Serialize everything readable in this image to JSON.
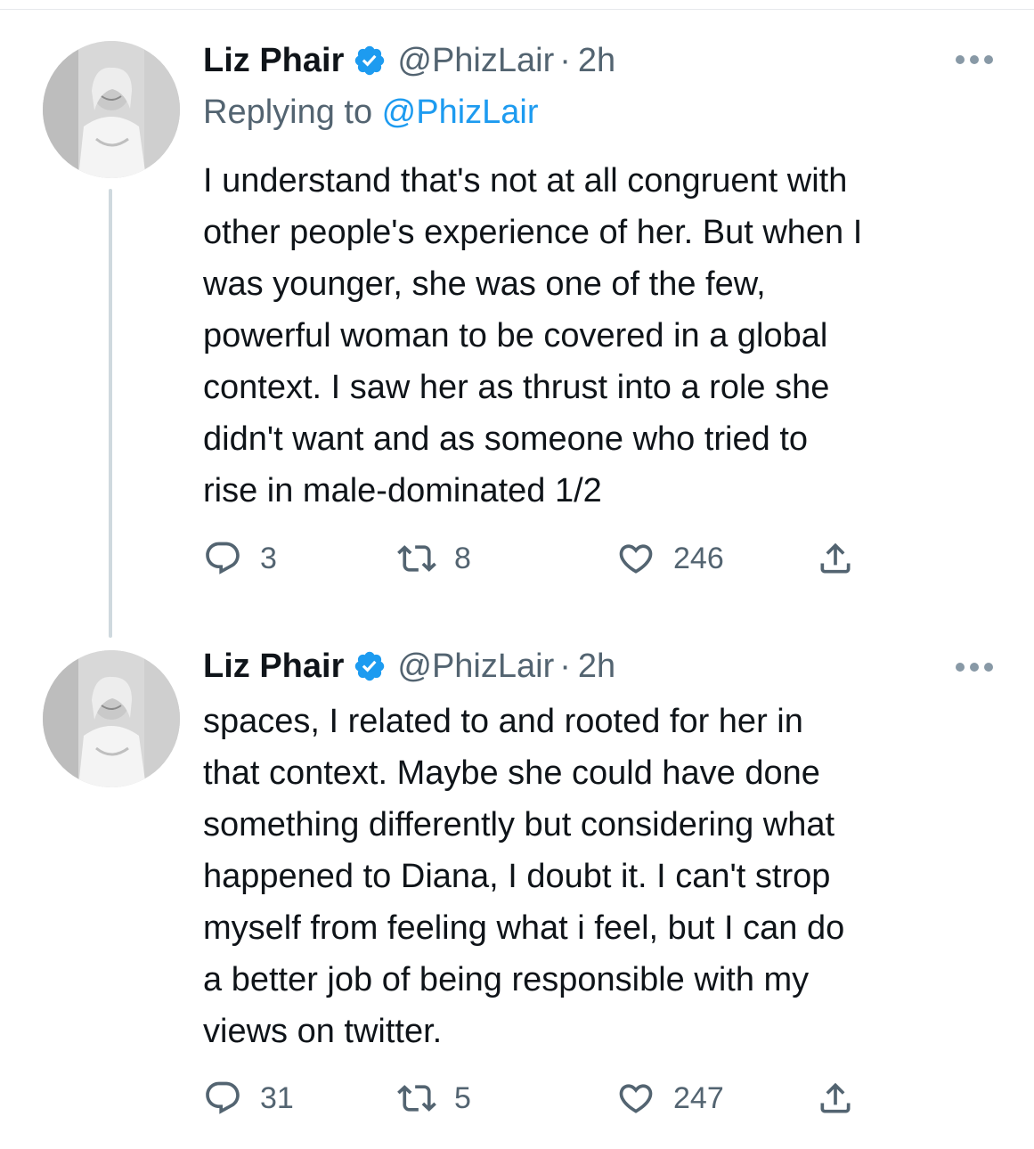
{
  "tweets": [
    {
      "author_name": "Liz Phair",
      "handle": "@PhizLair",
      "separator": "·",
      "time": "2h",
      "replying_prefix": "Replying to ",
      "replying_to": "@PhizLair",
      "text": "I understand that's not at all congruent with\nother people's experience of her. But when I\nwas younger, she was one of the few,\npowerful woman to be covered in a global\ncontext. I saw her as thrust into a role she\ndidn't want and as someone who tried to\nrise in male-dominated 1/2",
      "replies": "3",
      "retweets": "8",
      "likes": "246"
    },
    {
      "author_name": "Liz Phair",
      "handle": "@PhizLair",
      "separator": "·",
      "time": "2h",
      "text": "spaces, I related to and rooted for her in\nthat context. Maybe she could have done\nsomething differently but considering what\nhappened to Diana, I doubt it. I can't strop\nmyself from feeling what i feel, but I can do\na better job of being responsible with my\nviews on twitter.",
      "replies": "31",
      "retweets": "5",
      "likes": "247"
    }
  ],
  "colors": {
    "text": "#0f1419",
    "secondary": "#536471",
    "link": "#1d9bf0",
    "verified": "#1d9bf0",
    "thread_line": "#cfd9de"
  },
  "icons": {
    "verified": "verified-badge-icon",
    "more": "more-dots-icon",
    "reply": "reply-bubble-icon",
    "retweet": "retweet-arrows-icon",
    "like": "heart-icon",
    "share": "share-upload-icon"
  }
}
